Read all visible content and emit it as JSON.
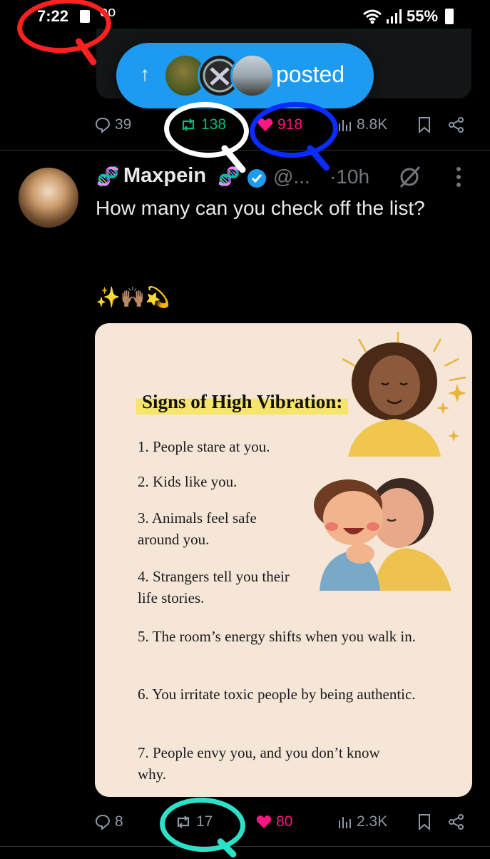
{
  "status_bar": {
    "time": "7:22",
    "voicemail": "oo",
    "battery": "55%"
  },
  "posted_pill": {
    "label": "posted",
    "arrow": "↑"
  },
  "top_actions": {
    "replies": "39",
    "reposts": "138",
    "likes": "918",
    "views": "8.8K"
  },
  "tweet": {
    "display_name": "Maxpein",
    "name_decor": "🧬",
    "handle": "@...",
    "time": "·10h",
    "text": "How many can you check off the list?",
    "emoji": "✨🙌🏽💫"
  },
  "card": {
    "title": "Signs of High Vibration:",
    "items": [
      "1. People stare at you.",
      "2. Kids like you.",
      "3. Animals feel safe around you.",
      "4. Strangers tell you their life stories.",
      "5. The room’s energy shifts when you walk in.",
      "6. You irritate toxic people by being authentic.",
      "7. People envy you, and you don’t know why."
    ]
  },
  "bottom_actions": {
    "replies": "8",
    "reposts": "17",
    "likes": "80",
    "views": "2.3K"
  },
  "colors": {
    "accent": "#1d9bf0",
    "repost": "#00ba7c",
    "like": "#f91880",
    "annot_red": "#ff2020",
    "annot_white": "#ffffff",
    "annot_blue": "#0a2cff",
    "annot_teal": "#2de0c8"
  }
}
